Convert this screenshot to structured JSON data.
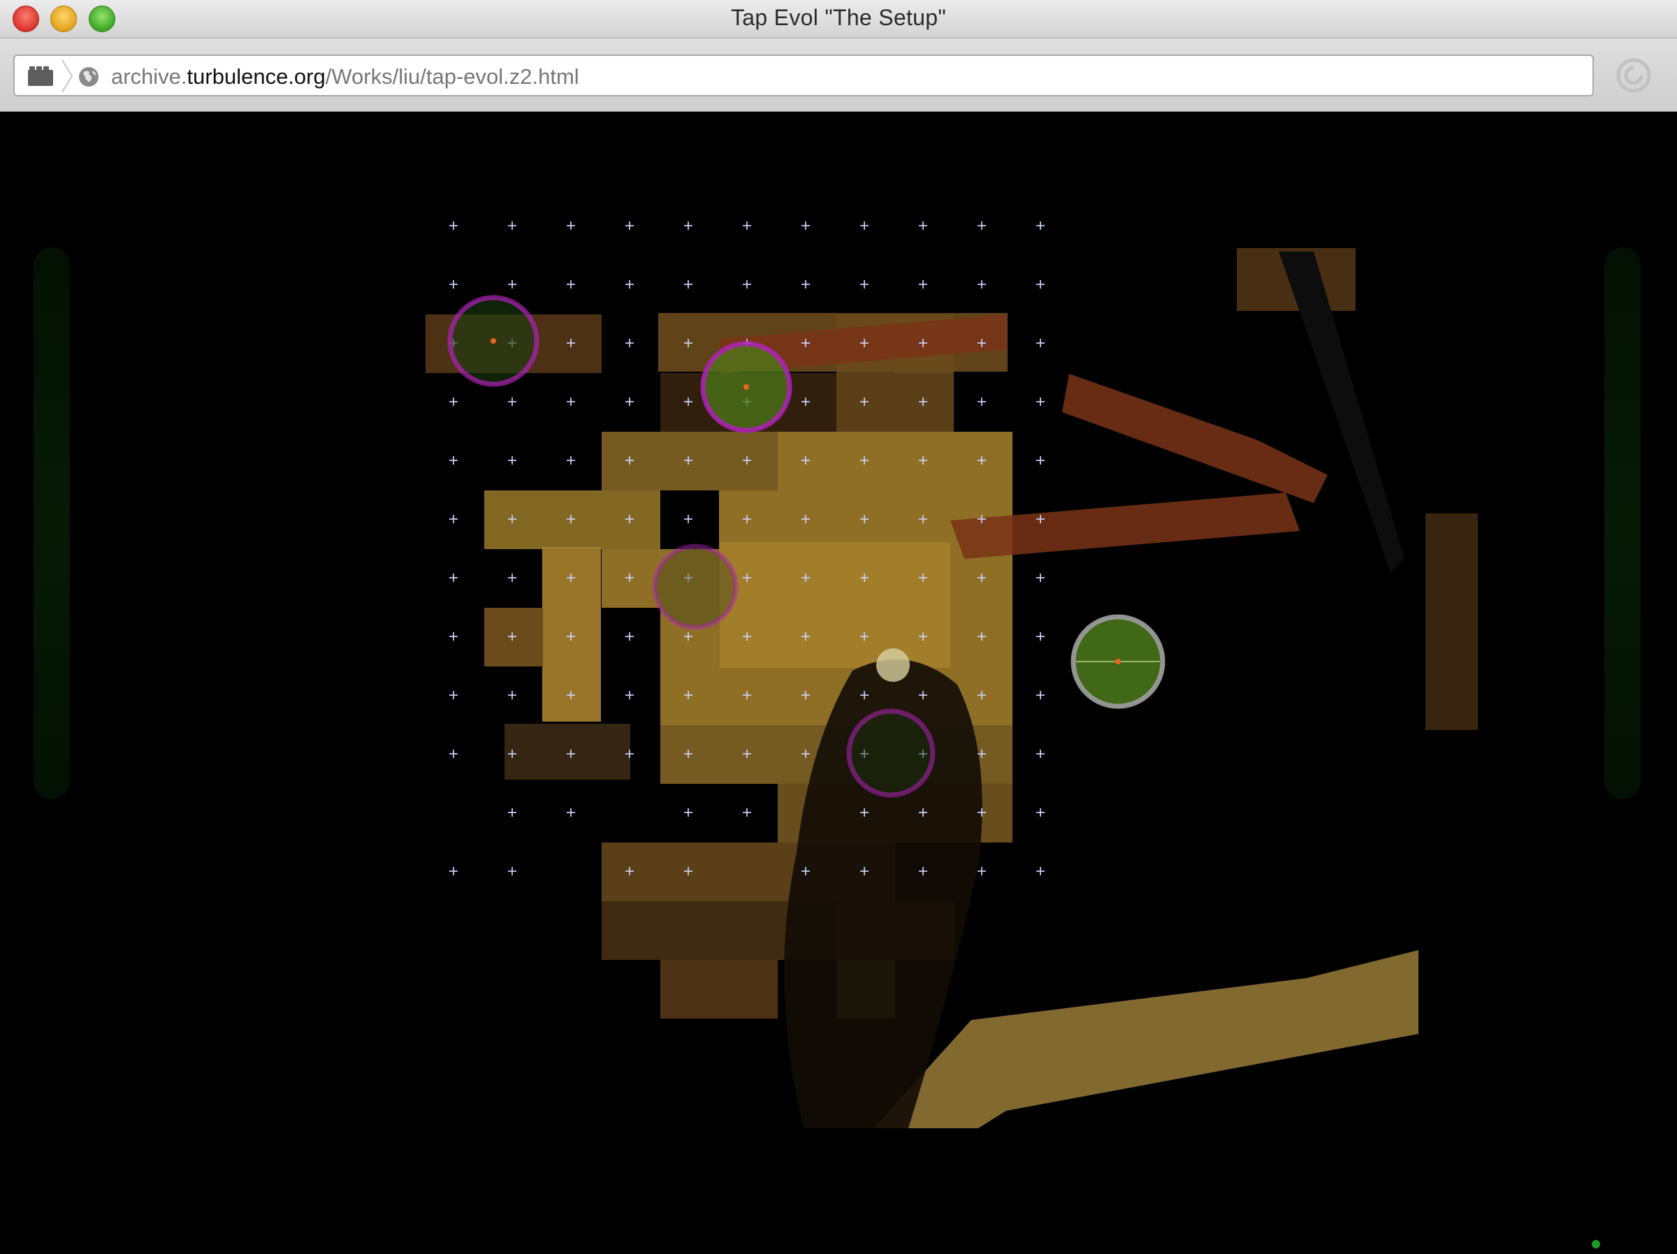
{
  "window": {
    "title": "Tap Evol \"The Setup\""
  },
  "address_bar": {
    "url_prefix": "archive.",
    "url_host": "turbulence.org",
    "url_path": "/Works/liu/tap-evol.z2.html"
  },
  "icons": {
    "close": "close-icon",
    "minimize": "minimize-icon",
    "maximize": "maximize-icon",
    "tabs": "tabs-icon",
    "site": "globe-icon",
    "reader": "reader-icon"
  },
  "colors": {
    "tile_gold": "#a8822c",
    "tile_dark": "#3a2a10",
    "rust": "#7a3418",
    "marker_magenta": "#b021b8",
    "marker_fill_green": "#4c7a1a",
    "marker_grey": "#9a9a9a",
    "crosshair": "#c9d3ff",
    "status_green": "#1f9a2c"
  },
  "artwork": {
    "active_markers": 4,
    "selected_markers": 1
  }
}
